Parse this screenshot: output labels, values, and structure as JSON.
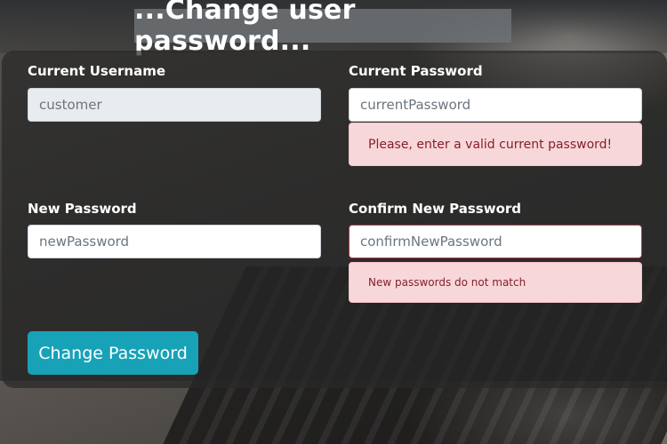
{
  "header": {
    "title": "...Change user password..."
  },
  "form": {
    "current_username": {
      "label": "Current Username",
      "value": "customer"
    },
    "current_password": {
      "label": "Current Password",
      "placeholder": "currentPassword",
      "error": "Please, enter a valid current password!"
    },
    "new_password": {
      "label": "New Password",
      "placeholder": "newPassword"
    },
    "confirm_new_password": {
      "label": "Confirm New Password",
      "placeholder": "confirmNewPassword",
      "error": "New passwords do not match"
    },
    "submit_label": "Change Password"
  },
  "colors": {
    "button": "#17a2b8",
    "alert_bg": "#f8d7da",
    "alert_text": "#842029",
    "card_bg": "rgba(40,40,40,0.72)"
  }
}
